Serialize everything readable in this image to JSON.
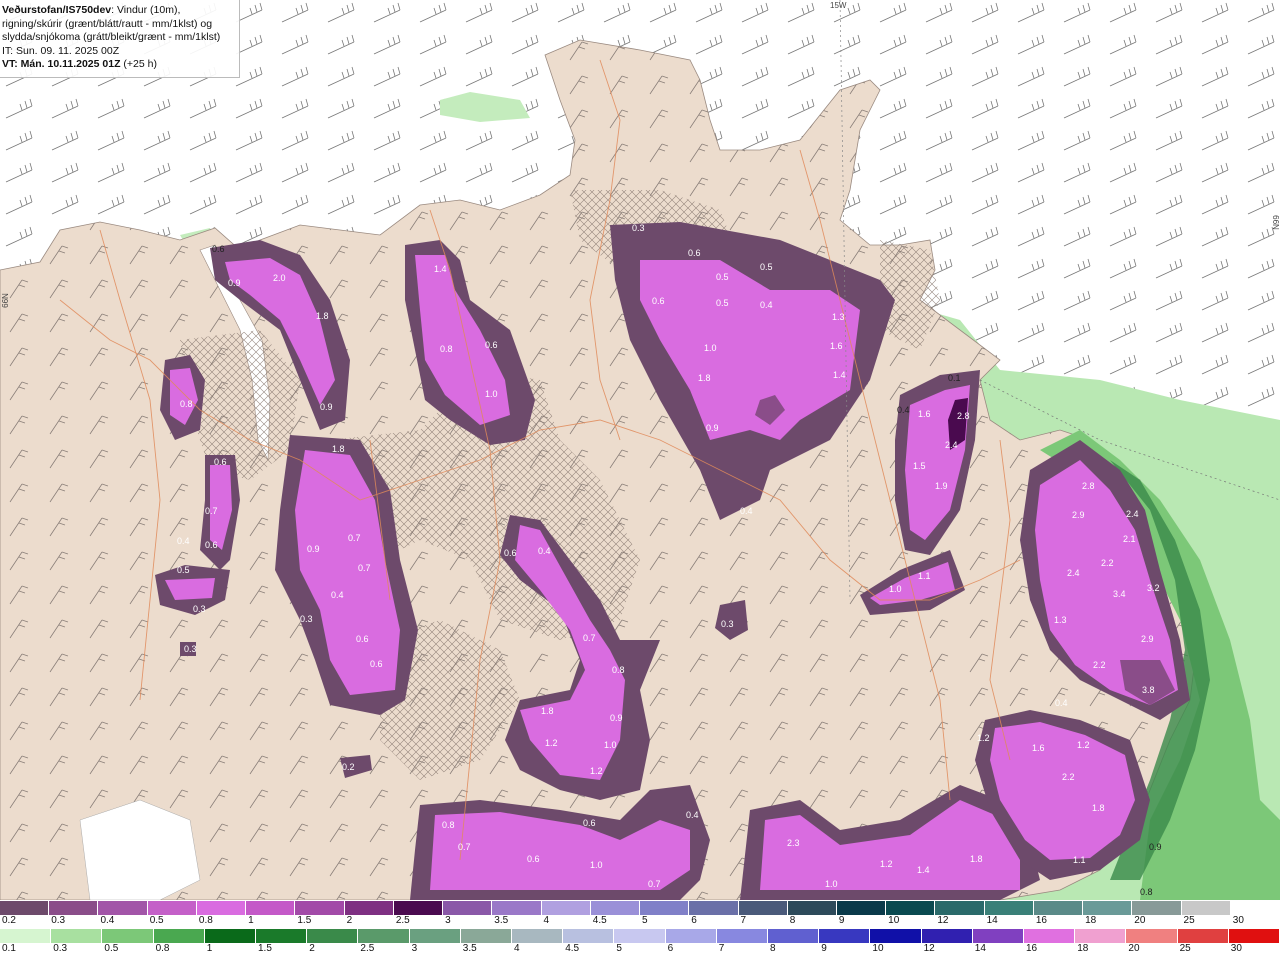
{
  "header": {
    "source": "Veðurstofan/IS750dev",
    "line1_rest": ": Vindur (10m),",
    "line2": "rigning/skúrir (grænt/blátt/rautt - mm/1klst) og",
    "line3": "slydda/snjókoma (grátt/bleikt/grænt - mm/1klst)",
    "line4": "IT: Sun. 09. 11. 2025 00Z",
    "line5_bold": "VT: Mán. 10.11.2025 01Z",
    "line5_rest": " (+25 h)"
  },
  "grid_labels": {
    "top": "15W",
    "right": "66N",
    "left": "66N"
  },
  "colors": {
    "land": "#ecdccd",
    "sea": "#ffffff",
    "rain_light": "#b9e8b3",
    "snow_dark": "#6d3f6b",
    "snow_light": "#e070e8",
    "roads": "#e08a5a"
  },
  "snow_bar": {
    "labels": [
      "0.2",
      "0.3",
      "0.4",
      "0.5",
      "0.8",
      "1",
      "1.5",
      "2",
      "2.5",
      "3",
      "3.5",
      "4",
      "4.5",
      "5",
      "6",
      "7",
      "8",
      "9",
      "10",
      "12",
      "14",
      "16",
      "18",
      "20",
      "25",
      "30"
    ],
    "colors": [
      "#6d4a6b",
      "#8a4d89",
      "#a255a8",
      "#c460c8",
      "#d96ce0",
      "#c459c8",
      "#a24aa8",
      "#7e2f82",
      "#4a0a4f",
      "#8a58a8",
      "#9a78c8",
      "#b0a0e0",
      "#9a90d8",
      "#8080c8",
      "#6a70a8",
      "#4a5a7a",
      "#2d4a5a",
      "#0a3a4a",
      "#0a4a50",
      "#2a6a6a",
      "#3a8078",
      "#5a8a88",
      "#6a9a98",
      "#889a98",
      "#c8c8c8",
      "#ffffff"
    ]
  },
  "rain_bar": {
    "labels": [
      "0.1",
      "0.3",
      "0.5",
      "0.8",
      "1",
      "1.5",
      "2",
      "2.5",
      "3",
      "3.5",
      "4",
      "4.5",
      "5",
      "6",
      "7",
      "8",
      "9",
      "10",
      "12",
      "14",
      "16",
      "18",
      "20",
      "25",
      "30"
    ],
    "colors": [
      "#d6f5d0",
      "#a8e0a0",
      "#7cc878",
      "#4aa850",
      "#0a6a1a",
      "#1a7a2a",
      "#3a8a4a",
      "#5a9a6a",
      "#6aa080",
      "#8aa898",
      "#a8b8c0",
      "#b8c0e0",
      "#c8c8f0",
      "#a8a8e8",
      "#8888e0",
      "#6060d0",
      "#3838c0",
      "#1010a8",
      "#3020b0",
      "#8040c0",
      "#e070e0",
      "#f0a0d0",
      "#f08080",
      "#e04040",
      "#e01010"
    ]
  },
  "map_values": [
    {
      "id": "v1",
      "text": "0.3"
    },
    {
      "id": "v2",
      "text": "0.6"
    },
    {
      "id": "v3",
      "text": "0.5"
    },
    {
      "id": "v4",
      "text": "0.6"
    },
    {
      "id": "v5",
      "text": "0.5"
    },
    {
      "id": "v6",
      "text": "0.5"
    },
    {
      "id": "v7",
      "text": "0.4"
    },
    {
      "id": "v8",
      "text": "1.3"
    },
    {
      "id": "v9",
      "text": "1.6"
    },
    {
      "id": "v10",
      "text": "1.4"
    },
    {
      "id": "v11",
      "text": "1.0"
    },
    {
      "id": "v12",
      "text": "1.8"
    },
    {
      "id": "v13",
      "text": "0.9"
    },
    {
      "id": "v14",
      "text": "0.4"
    },
    {
      "id": "v15",
      "text": "2.0"
    },
    {
      "id": "v16",
      "text": "0.9"
    },
    {
      "id": "v17",
      "text": "1.8"
    },
    {
      "id": "v18",
      "text": "0.9"
    },
    {
      "id": "v19",
      "text": "1.8"
    },
    {
      "id": "v20",
      "text": "1.4"
    },
    {
      "id": "v21",
      "text": "0.8"
    },
    {
      "id": "v22",
      "text": "0.6"
    },
    {
      "id": "v23",
      "text": "1.0"
    },
    {
      "id": "v24",
      "text": "0.8"
    },
    {
      "id": "v25",
      "text": "0.6"
    },
    {
      "id": "v26",
      "text": "0.7"
    },
    {
      "id": "v27",
      "text": "0.4"
    },
    {
      "id": "v28",
      "text": "0.6"
    },
    {
      "id": "v29",
      "text": "0.5"
    },
    {
      "id": "v30",
      "text": "0.3"
    },
    {
      "id": "v31",
      "text": "0.9"
    },
    {
      "id": "v32",
      "text": "0.7"
    },
    {
      "id": "v33",
      "text": "0.7"
    },
    {
      "id": "v34",
      "text": "0.4"
    },
    {
      "id": "v35",
      "text": "0.3"
    },
    {
      "id": "v36",
      "text": "0.6"
    },
    {
      "id": "v37",
      "text": "0.6"
    },
    {
      "id": "v38",
      "text": "0.3"
    },
    {
      "id": "v39",
      "text": "0.6"
    },
    {
      "id": "v40",
      "text": "0.4"
    },
    {
      "id": "v41",
      "text": "0.7"
    },
    {
      "id": "v42",
      "text": "0.8"
    },
    {
      "id": "v43",
      "text": "0.3"
    },
    {
      "id": "v44",
      "text": "1.8"
    },
    {
      "id": "v45",
      "text": "0.9"
    },
    {
      "id": "v46",
      "text": "1.2"
    },
    {
      "id": "v47",
      "text": "1.0"
    },
    {
      "id": "v48",
      "text": "1.2"
    },
    {
      "id": "v49",
      "text": "0.2"
    },
    {
      "id": "v50",
      "text": "0.8"
    },
    {
      "id": "v51",
      "text": "0.7"
    },
    {
      "id": "v52",
      "text": "0.6"
    },
    {
      "id": "v53",
      "text": "0.6"
    },
    {
      "id": "v54",
      "text": "1.0"
    },
    {
      "id": "v55",
      "text": "0.4"
    },
    {
      "id": "v56",
      "text": "0.7"
    },
    {
      "id": "v57",
      "text": "2.3"
    },
    {
      "id": "v58",
      "text": "1.0"
    },
    {
      "id": "v59",
      "text": "1.2"
    },
    {
      "id": "v60",
      "text": "1.4"
    },
    {
      "id": "v61",
      "text": "1.8"
    },
    {
      "id": "v62",
      "text": "1.6"
    },
    {
      "id": "v63",
      "text": "2.8"
    },
    {
      "id": "v64",
      "text": "2.4"
    },
    {
      "id": "v65",
      "text": "1.5"
    },
    {
      "id": "v66",
      "text": "1.9"
    },
    {
      "id": "v67",
      "text": "1.1"
    },
    {
      "id": "v68",
      "text": "1.0"
    },
    {
      "id": "v69",
      "text": "2.8"
    },
    {
      "id": "v70",
      "text": "2.9"
    },
    {
      "id": "v71",
      "text": "2.4"
    },
    {
      "id": "v72",
      "text": "2.1"
    },
    {
      "id": "v73",
      "text": "2.2"
    },
    {
      "id": "v74",
      "text": "2.4"
    },
    {
      "id": "v75",
      "text": "3.4"
    },
    {
      "id": "v76",
      "text": "3.2"
    },
    {
      "id": "v77",
      "text": "1.3"
    },
    {
      "id": "v78",
      "text": "2.9"
    },
    {
      "id": "v79",
      "text": "2.2"
    },
    {
      "id": "v80",
      "text": "3.8"
    },
    {
      "id": "v81",
      "text": "0.4"
    },
    {
      "id": "v82",
      "text": "1.2"
    },
    {
      "id": "v83",
      "text": "1.6"
    },
    {
      "id": "v84",
      "text": "1.2"
    },
    {
      "id": "v85",
      "text": "2.2"
    },
    {
      "id": "v86",
      "text": "1.8"
    },
    {
      "id": "v87",
      "text": "1.1"
    },
    {
      "id": "v88",
      "text": "0.9"
    },
    {
      "id": "v89",
      "text": "0.8"
    },
    {
      "id": "v90",
      "text": "0.1"
    },
    {
      "id": "v91",
      "text": "0.6"
    },
    {
      "id": "v92",
      "text": "0.4"
    }
  ]
}
